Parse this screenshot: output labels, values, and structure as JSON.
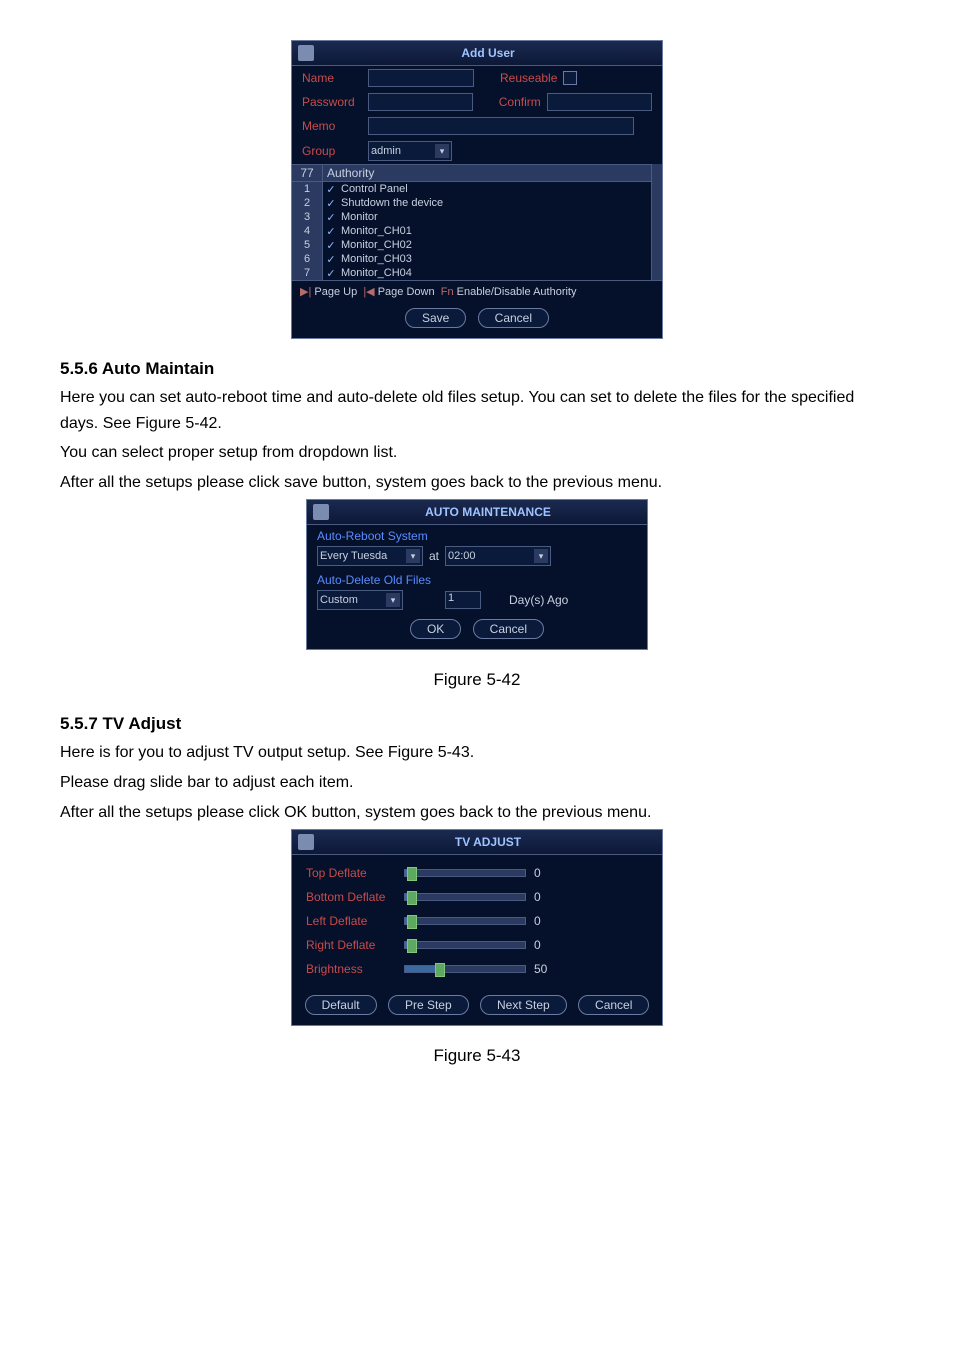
{
  "addUser": {
    "title": "Add User",
    "nameLabel": "Name",
    "reuseableLabel": "Reuseable",
    "passwordLabel": "Password",
    "confirmLabel": "Confirm",
    "memoLabel": "Memo",
    "groupLabel": "Group",
    "groupValue": "admin",
    "authorityCount": "77",
    "authorityHeader": "Authority",
    "rows": [
      {
        "n": "1",
        "text": "Control Panel"
      },
      {
        "n": "2",
        "text": "Shutdown the device"
      },
      {
        "n": "3",
        "text": "Monitor"
      },
      {
        "n": "4",
        "text": "Monitor_CH01"
      },
      {
        "n": "5",
        "text": "Monitor_CH02"
      },
      {
        "n": "6",
        "text": "Monitor_CH03"
      },
      {
        "n": "7",
        "text": "Monitor_CH04"
      }
    ],
    "hintPageUp": "Page Up",
    "hintPageDown": "Page Down",
    "hintEnable": "Enable/Disable Authority",
    "save": "Save",
    "cancel": "Cancel"
  },
  "section1": {
    "heading": "5.5.6  Auto Maintain",
    "p1": "Here you can set auto-reboot time and auto-delete old files setup. You can set to delete the files for the specified days. See Figure 5-42.",
    "p2": "You can select proper setup from dropdown list.",
    "p3": "After all the setups please click save button, system goes back to the previous menu."
  },
  "autoMaint": {
    "title": "AUTO MAINTENANCE",
    "rebootLabel": "Auto-Reboot System",
    "dayValue": "Every Tuesda",
    "atLabel": "at",
    "timeValue": "02:00",
    "deleteLabel": "Auto-Delete Old Files",
    "customValue": "Custom",
    "daysValue": "1",
    "daysAgo": "Day(s) Ago",
    "ok": "OK",
    "cancel": "Cancel"
  },
  "fig42": "Figure 5-42",
  "section2": {
    "heading": "5.5.7  TV Adjust",
    "p1": "Here is for you to adjust TV output setup. See Figure 5-43.",
    "p2": "Please drag slide bar to adjust each item.",
    "p3": "After all the setups please click OK button, system goes back to the previous menu."
  },
  "tvAdjust": {
    "title": "TV ADJUST",
    "sliders": [
      {
        "label": "Top Deflate",
        "value": "0",
        "pct": 2
      },
      {
        "label": "Bottom Deflate",
        "value": "0",
        "pct": 2
      },
      {
        "label": "Left Deflate",
        "value": "0",
        "pct": 2
      },
      {
        "label": "Right Deflate",
        "value": "0",
        "pct": 2
      },
      {
        "label": "Brightness",
        "value": "50",
        "pct": 25
      }
    ],
    "default": "Default",
    "preStep": "Pre Step",
    "nextStep": "Next Step",
    "cancel": "Cancel"
  },
  "fig43": "Figure 5-43"
}
